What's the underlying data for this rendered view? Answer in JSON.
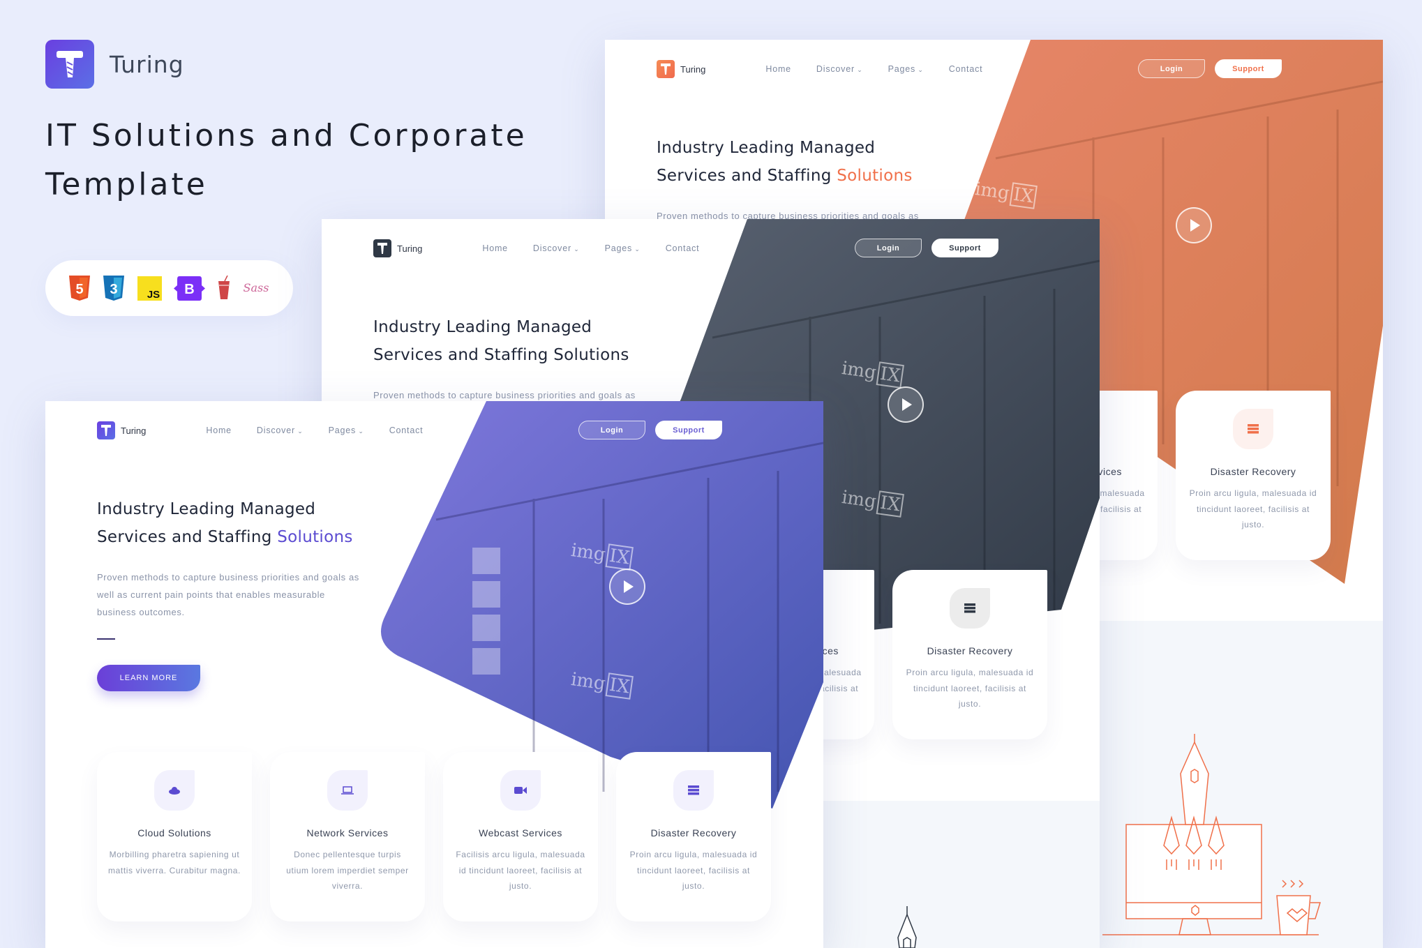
{
  "brand": {
    "name": "Turing",
    "logo_icon": "turing-t-drill-icon",
    "headline": "IT Solutions and Corporate Template"
  },
  "tech_stack": [
    {
      "name": "HTML5",
      "icon": "html5-icon",
      "label": "5",
      "color": "#e44d26"
    },
    {
      "name": "CSS3",
      "icon": "css3-icon",
      "label": "3",
      "color": "#2965f1"
    },
    {
      "name": "JavaScript",
      "icon": "javascript-icon",
      "label": "JS",
      "color": "#f7df1e"
    },
    {
      "name": "Bootstrap",
      "icon": "bootstrap-icon",
      "label": "B",
      "color": "#7952b3"
    },
    {
      "name": "Gulp",
      "icon": "gulp-icon",
      "label": "",
      "color": "#cf4647"
    },
    {
      "name": "Sass",
      "icon": "sass-icon",
      "label": "Sass",
      "color": "#cd6799"
    }
  ],
  "template": {
    "logo_name": "Turing",
    "nav": [
      "Home",
      "Discover",
      "Pages",
      "Contact"
    ],
    "login_label": "Login",
    "support_label": "Support",
    "hero_title_line1": "Industry Leading Managed",
    "hero_title_line2": "Services and Staffing ",
    "hero_title_accent": "Solutions",
    "hero_desc": "Proven methods to capture business priorities and goals as well as current pain points that enables measurable business outcomes.",
    "learn_more": "LEARN MORE",
    "watermark": "img",
    "watermark_box": "IX",
    "services": [
      {
        "title": "Cloud Solutions",
        "desc": "Morbilling pharetra sapiening ut mattis viverra. Curabitur magna.",
        "icon": "cloud-icon"
      },
      {
        "title": "Network Services",
        "desc": "Donec pellentesque turpis utium lorem imperdiet semper viverra.",
        "icon": "laptop-icon"
      },
      {
        "title": "Webcast Services",
        "desc": "Facilisis arcu ligula, malesuada id tincidunt laoreet, facilisis at justo.",
        "icon": "video-camera-icon"
      },
      {
        "title": "Disaster Recovery",
        "desc": "Proin arcu ligula, malesuada id tincidunt laoreet, facilisis at justo.",
        "icon": "server-icon"
      }
    ]
  },
  "themes": {
    "purple": {
      "accent": "#5b4bd1",
      "gradient_from": "#6a3fe0",
      "gradient_to": "#5a78e0",
      "overlay": "#5a56c8",
      "icon_bg": "#f2f1fd"
    },
    "dark": {
      "accent": "#2f3845",
      "overlay": "#3a4350",
      "icon_bg": "#ececec"
    },
    "orange": {
      "accent": "#f0704a",
      "overlay": "#e57f55",
      "icon_bg": "#fdf1ee"
    }
  }
}
